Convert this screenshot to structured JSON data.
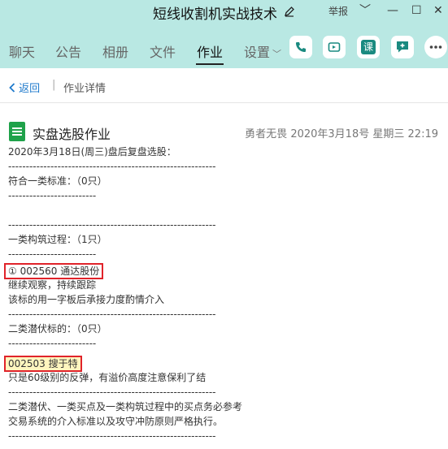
{
  "window": {
    "title": "短线收割机实战技术",
    "report_label": "举报",
    "controls": [
      "﹀",
      "—",
      "☐",
      "✕"
    ]
  },
  "tabs": [
    {
      "label": "聊天"
    },
    {
      "label": "公告"
    },
    {
      "label": "相册"
    },
    {
      "label": "文件"
    },
    {
      "label": "作业",
      "active": true
    },
    {
      "label": "设置"
    }
  ],
  "toolbar_icons": [
    "phone-icon",
    "video-call-icon",
    "lesson-icon",
    "add-chat-icon",
    "more-icon"
  ],
  "toolbar_lesson_label": "课",
  "breadcrumb": {
    "back_label": "返回",
    "separator": "|",
    "current": "作业详情"
  },
  "homework": {
    "title": "实盘选股作业",
    "author": "勇者无畏",
    "date": "2020年3月18号",
    "weekday": "星期三",
    "time": "22:19",
    "lines": [
      "2020年3月18日(周三)盘后复盘选股：",
      "-----------------------------------------------------------",
      "符合一类标准：（0只）",
      "-------------------------",
      "",
      "-----------------------------------------------------------",
      "一类构筑过程：（1只）",
      "-------------------------",
      "① 002560 通达股份",
      "继续观察，持续跟踪",
      "该标的用一字板后承接力度酌情介入",
      "-----------------------------------------------------------",
      "二类潜伏标的：（0只）",
      "-------------------------",
      "002503 搜于特",
      "只是60级别的反弹，有溢价高度注意保利了结",
      "-----------------------------------------------------------",
      "二类潜伏、一类买点及一类构筑过程中的买点务必参考",
      "交易系统的介入标准以及攻守冲防原则严格执行。",
      "-----------------------------------------------------------"
    ]
  },
  "colors": {
    "header_bg": "#b9e8e3",
    "accent_teal": "#1a8a80",
    "link_blue": "#1f7acc",
    "highlight_red": "#e0232a",
    "doc_green": "#1fa24a"
  }
}
